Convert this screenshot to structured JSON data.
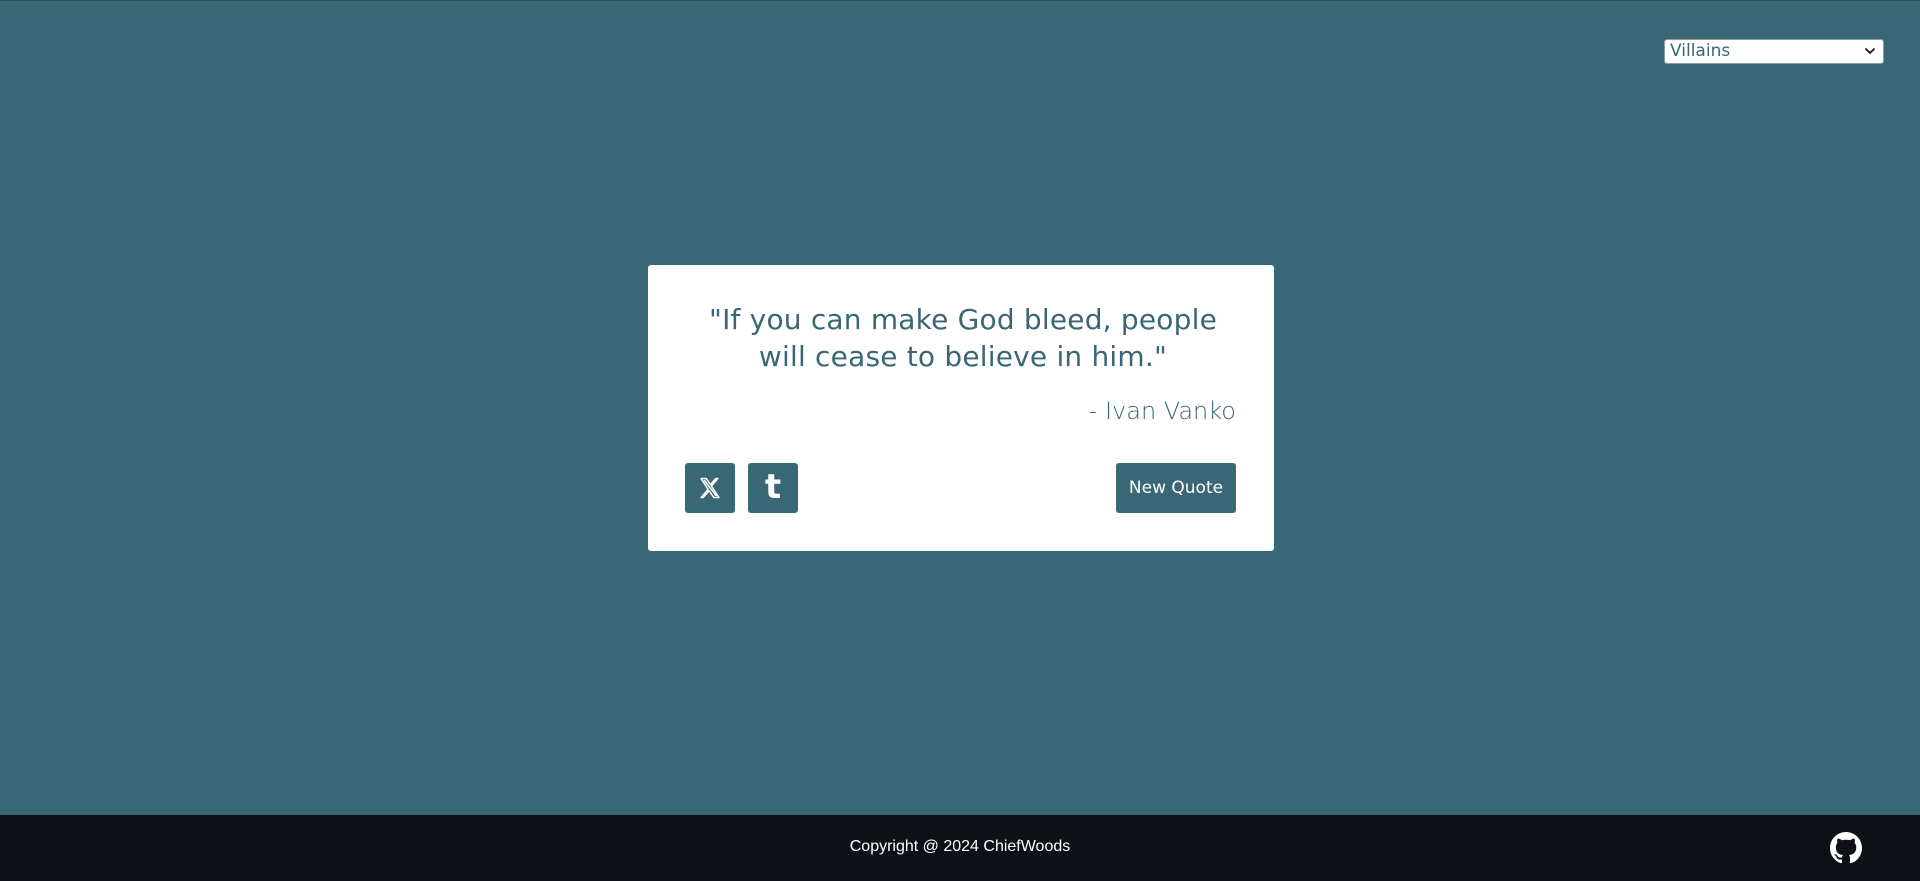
{
  "category_select": {
    "selected": "Villains",
    "icon": "chevron-down-icon"
  },
  "quote": {
    "text": "\"If you can make God bleed, people will cease to believe in him.\"",
    "author": "- Ivan Vanko"
  },
  "actions": {
    "tweet_icon": "x-twitter-icon",
    "tumblr_icon": "tumblr-icon",
    "tumblr_glyph": "t",
    "new_quote_label": "New Quote"
  },
  "footer": {
    "copyright": "Copyright @ 2024 ChiefWoods",
    "github_icon": "github-icon"
  },
  "colors": {
    "background": "#3a6776",
    "card": "#ffffff",
    "footer": "#0d1117",
    "accent_text": "#3a6776"
  }
}
